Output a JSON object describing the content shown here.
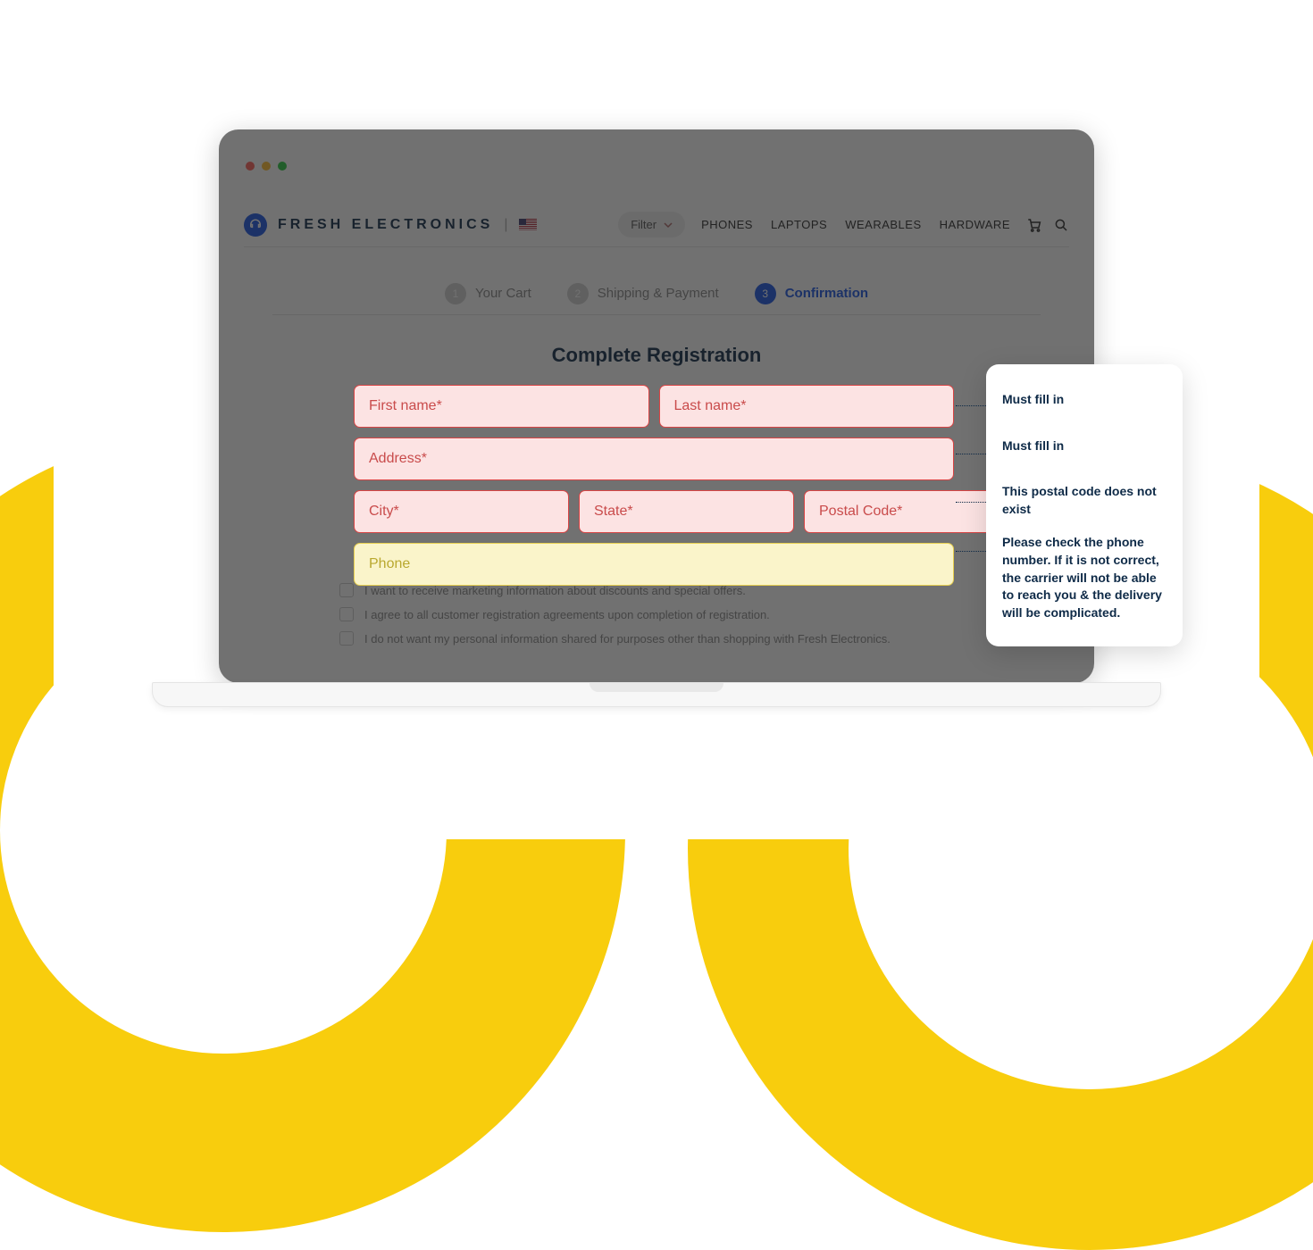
{
  "brand": "FRESH ELECTRONICS",
  "filter_label": "Filter",
  "nav": [
    "PHONES",
    "LAPTOPS",
    "WEARABLES",
    "HARDWARE"
  ],
  "steps": [
    {
      "num": "1",
      "label": "Your Cart"
    },
    {
      "num": "2",
      "label": "Shipping & Payment"
    },
    {
      "num": "3",
      "label": "Confirmation"
    }
  ],
  "form_title": "Complete Registration",
  "fields": {
    "first_name": "First name*",
    "last_name": "Last name*",
    "address": "Address*",
    "city": "City*",
    "state": "State*",
    "postal": "Postal Code*",
    "phone": "Phone"
  },
  "checks": [
    "I want to receive marketing information about discounts and special offers.",
    "I agree to all customer registration agreements upon completion of registration.",
    "I do not want my personal information shared for purposes other than shopping with Fresh Electronics."
  ],
  "tips": {
    "t1": "Must fill in",
    "t2": "Must fill in",
    "t3": "This postal code does not exist",
    "t4": "Please check the phone number. If it is not correct, the carrier will not be able to reach you & the delivery will be complicated."
  }
}
